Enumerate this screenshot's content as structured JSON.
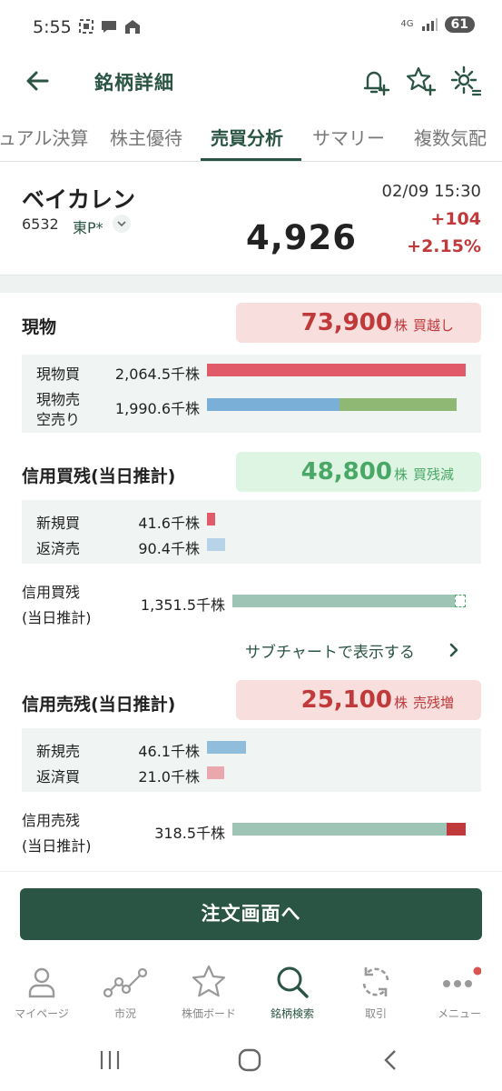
{
  "status_bar": {
    "time": "5:55",
    "network": "4G",
    "battery": "61"
  },
  "header": {
    "title": "銘柄詳細"
  },
  "tabs": [
    {
      "label": "ュアル決算"
    },
    {
      "label": "株主優待"
    },
    {
      "label": "売買分析"
    },
    {
      "label": "サマリー"
    },
    {
      "label": "複数気配"
    }
  ],
  "stock": {
    "name": "ベイカレン",
    "code": "6532",
    "market": "東P*",
    "datetime": "02/09 15:30",
    "price": "4,926",
    "change": "+104",
    "change_pct": "+2.15%"
  },
  "spot": {
    "title": "現物",
    "net_value": "73,900",
    "net_unit": "株",
    "net_tag": "買越し",
    "buy_label": "現物買",
    "buy_value": "2,064.5千株",
    "sell_label_1": "現物売",
    "sell_label_2": "空売り",
    "sell_value": "1,990.6千株",
    "buy_ratio": 1.0,
    "sell_ratio": 0.964,
    "sell_split": {
      "spot": 0.53,
      "short": 0.47
    }
  },
  "margin_buy": {
    "title": "信用買残(当日推計)",
    "net_value": "48,800",
    "net_unit": "株",
    "net_tag": "買残減",
    "new_label": "新規買",
    "new_value": "41.6千株",
    "repay_label": "返済売",
    "repay_value": "90.4千株",
    "total_label_1": "信用買残",
    "total_label_2": "(当日推計)",
    "total_value": "1,351.5千株",
    "new_ratio": 0.02,
    "repay_ratio": 0.044,
    "total_ratio": 1.0,
    "subchart_link": "サブチャートで表示する"
  },
  "margin_sell": {
    "title": "信用売残(当日推計)",
    "net_value": "25,100",
    "net_unit": "株",
    "net_tag": "売残増",
    "new_label": "新規売",
    "new_value": "46.1千株",
    "repay_label": "返済買",
    "repay_value": "21.0千株",
    "total_label_1": "信用売残",
    "total_label_2": "(当日推計)",
    "total_value": "318.5千株",
    "new_ratio": 0.054,
    "repay_ratio": 0.024,
    "total_ratio": 1.0,
    "total_increase_ratio": 0.08
  },
  "order_button": {
    "label": "注文画面へ"
  },
  "bottom_nav": [
    {
      "label": "マイページ",
      "icon": "person-icon"
    },
    {
      "label": "市況",
      "icon": "market-chart-icon"
    },
    {
      "label": "株価ボード",
      "icon": "star-icon"
    },
    {
      "label": "銘柄検索",
      "icon": "search-icon"
    },
    {
      "label": "取引",
      "icon": "refresh-icon"
    },
    {
      "label": "メニュー",
      "icon": "more-icon"
    }
  ],
  "colors": {
    "brand": "#2a5443",
    "up_red": "#c0393b",
    "down_green": "#4aa866",
    "buy_bar": "#e05a6a",
    "sell_bar_spot": "#7ab0d8",
    "sell_bar_short": "#8fb874",
    "total_bar": "#9dc4b4"
  }
}
